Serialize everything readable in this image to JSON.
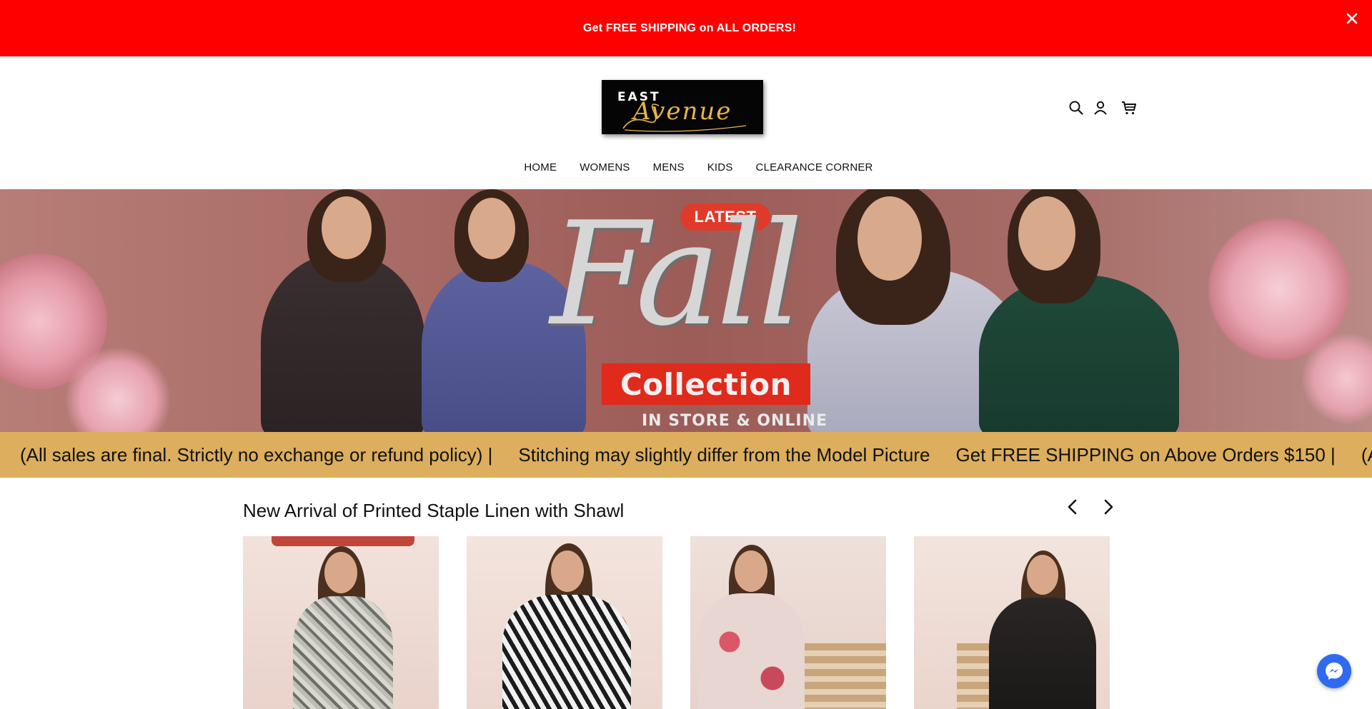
{
  "announcement": {
    "text": "Get FREE SHIPPING on ALL ORDERS!",
    "close_icon": "close-icon"
  },
  "header": {
    "logo": {
      "line1": "EAST",
      "line2": "Avenue"
    },
    "icons": [
      "search-icon",
      "account-icon",
      "cart-icon"
    ]
  },
  "nav": {
    "items": [
      {
        "label": "HOME"
      },
      {
        "label": "WOMENS"
      },
      {
        "label": "MENS"
      },
      {
        "label": "KIDS"
      },
      {
        "label": "CLEARANCE CORNER"
      }
    ]
  },
  "hero": {
    "badge": "LATEST",
    "headline": "Fall",
    "subheadline": "Collection",
    "tagline": "IN STORE & ONLINE"
  },
  "ticker": {
    "items": [
      "(All sales are final. Strictly no exchange or refund policy) |",
      "Stitching may slightly differ from the Model Picture",
      "Get FREE SHIPPING on Above Orders $150 |",
      "(A"
    ]
  },
  "section": {
    "title": "New Arrival of Printed Staple Linen with Shawl",
    "prev_icon": "chevron-left-icon",
    "next_icon": "chevron-right-icon"
  },
  "colors": {
    "announcement_bg": "#ff0000",
    "ticker_bg": "#dcae5d",
    "logo_gold": "#e8b44a",
    "messenger_blue": "#2f6bf0"
  }
}
